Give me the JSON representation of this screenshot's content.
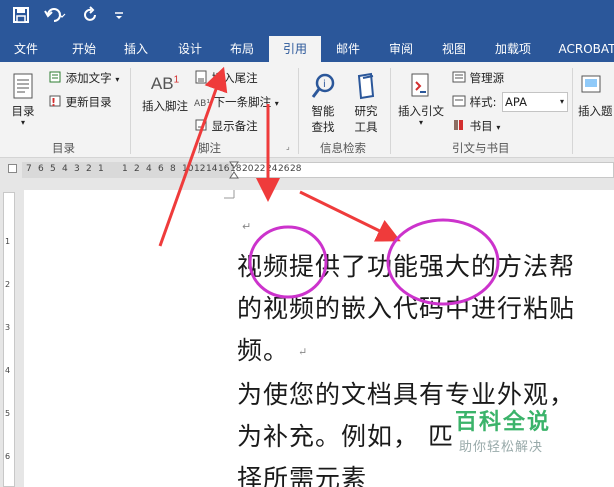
{
  "colors": {
    "accent": "#2b579a",
    "arrow": "#ef3b3b",
    "circle": "#cc33cc",
    "watermark": "#3bb36a"
  },
  "qat": {
    "icons": [
      "save-icon",
      "undo-icon",
      "redo-icon",
      "customize-icon"
    ]
  },
  "tabs": [
    {
      "label": "文件"
    },
    {
      "label": "开始"
    },
    {
      "label": "插入"
    },
    {
      "label": "设计"
    },
    {
      "label": "布局"
    },
    {
      "label": "引用"
    },
    {
      "label": "邮件"
    },
    {
      "label": "审阅"
    },
    {
      "label": "视图"
    },
    {
      "label": "加载项"
    },
    {
      "label": "ACROBAT"
    }
  ],
  "ribbon": {
    "toc": {
      "button": "目录",
      "add_text": "添加文字",
      "update_toc": "更新目录",
      "group": "目录"
    },
    "footnotes": {
      "insert_footnote": "插入脚注",
      "insert_endnote": "插入尾注",
      "next_footnote": "下一条脚注",
      "show_notes": "显示备注",
      "group": "脚注",
      "badge": "AB",
      "badge_sup": "1"
    },
    "research": {
      "smart_lookup": "智能\n查找",
      "smart_lookup_1": "智能",
      "smart_lookup_2": "查找",
      "researcher_1": "研究",
      "researcher_2": "工具",
      "group": "信息检索"
    },
    "citations": {
      "insert_citation": "插入引文",
      "manage_sources": "管理源",
      "style_label": "样式:",
      "style_value": "APA",
      "bibliography": "书目",
      "group": "引文与书目"
    },
    "captions": {
      "insert_caption": "插入题"
    }
  },
  "ruler": {
    "numbers": [
      "7",
      "6",
      "5",
      "4",
      "3",
      "2",
      "1",
      "",
      "1",
      "2",
      "4",
      "6",
      "8",
      "10",
      "12",
      "14",
      "16",
      "18",
      "20",
      "22",
      "24",
      "26",
      "28"
    ]
  },
  "vruler": {
    "numbers": [
      "1",
      "2",
      "3",
      "4",
      "5",
      "6"
    ]
  },
  "document": {
    "lines": [
      "视频提供了功能强大的方法帮",
      "的视频的嵌入代码中进行粘贴",
      "频。",
      "为使您的文档具有专业外观，",
      "为补充。例如，             匹",
      "择所需元素"
    ]
  },
  "watermark": {
    "title": "百科全说",
    "subtitle": "助你轻松解决"
  }
}
